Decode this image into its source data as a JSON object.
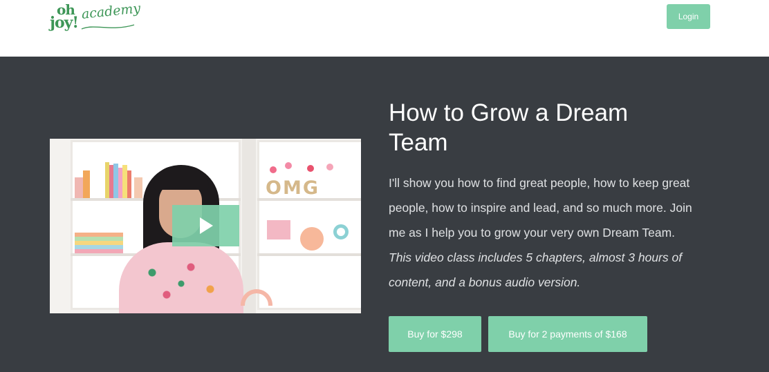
{
  "header": {
    "logo": {
      "line1": "oh",
      "line2": "joy!",
      "script": "academy"
    },
    "login_label": "Login"
  },
  "hero": {
    "video_sign_text": "OMG",
    "title": "How to Grow a Dream Team",
    "description_plain": "I'll show you how to find great people, how to keep great people, how to inspire and lead, and so much more. Join me as I help you to grow your very own Dream Team.",
    "description_italic": "This video class includes 5 chapters, almost 3 hours of content, and a bonus audio version.",
    "buy_full_label": "Buy for $298",
    "buy_installments_label": "Buy for 2 payments of $168"
  },
  "colors": {
    "accent": "#7fd0aa",
    "hero_background": "#393d42",
    "logo_green": "#3d9657",
    "text_light": "#dfe1e3"
  },
  "icons": {
    "play": "play-icon"
  }
}
